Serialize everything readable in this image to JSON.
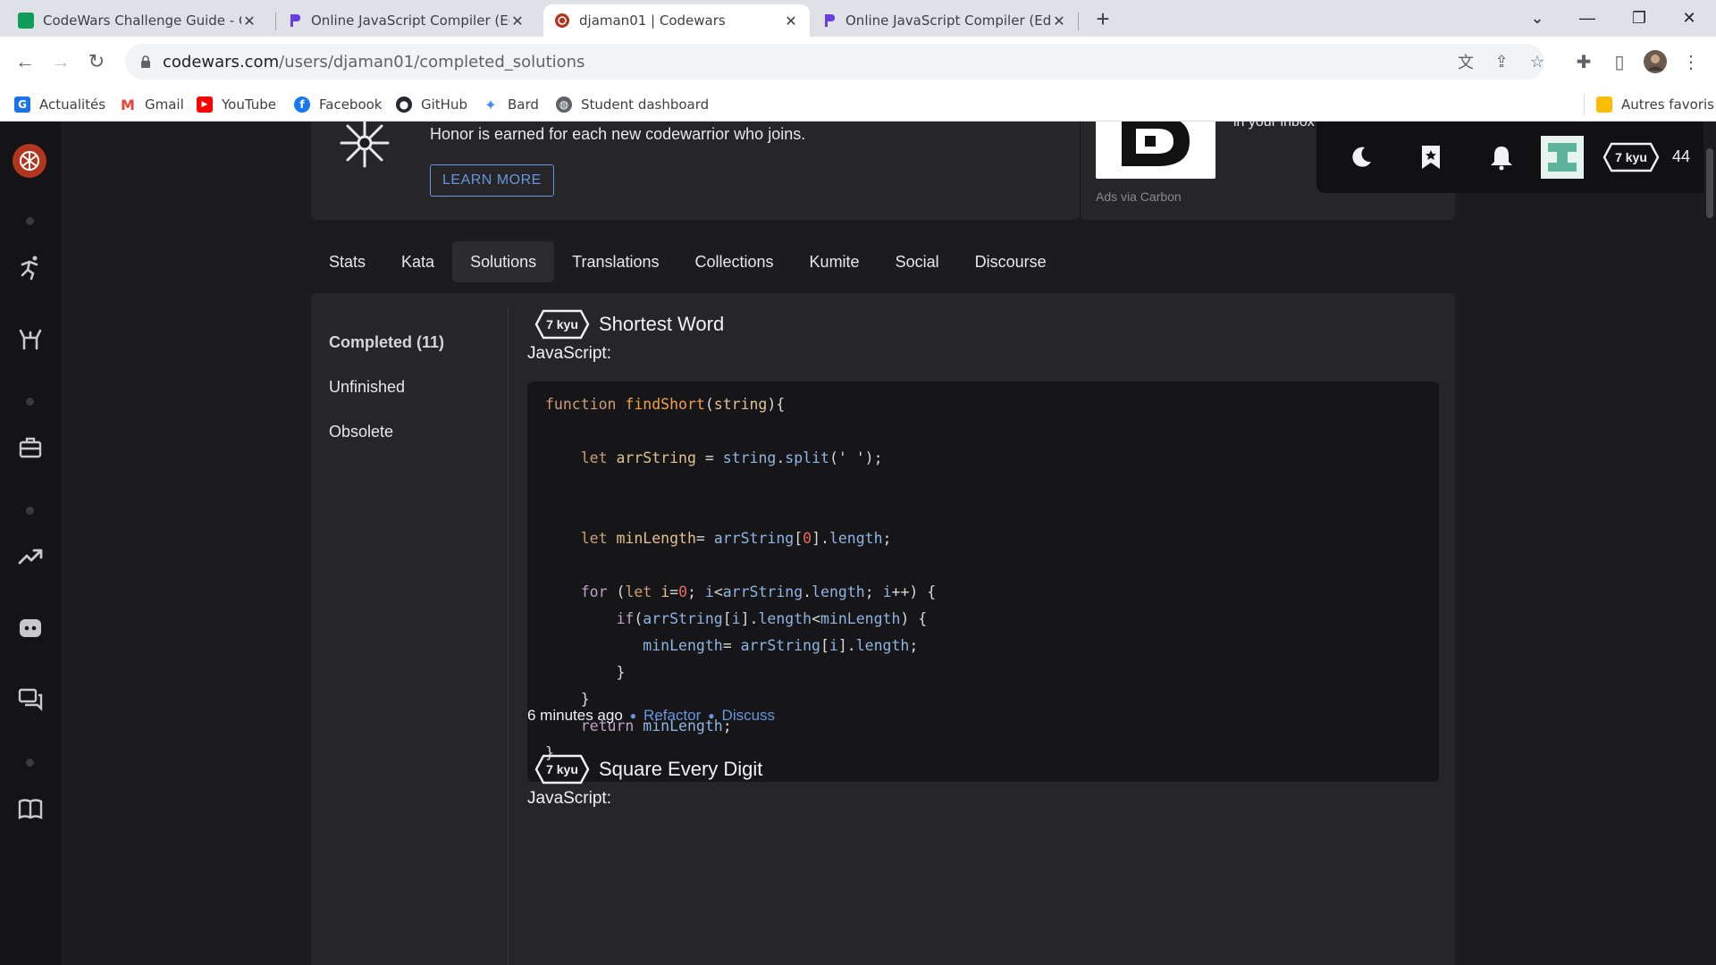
{
  "browser": {
    "tabs": [
      {
        "title": "CodeWars Challenge Guide - Google Sheets",
        "icon": "sheets-icon",
        "color": "#0f9d58"
      },
      {
        "title": "Online JavaScript Compiler (Editor)",
        "icon": "programiz-icon",
        "color": "#6c3de0"
      },
      {
        "title": "djaman01 | Codewars",
        "icon": "codewars-icon",
        "color": "#b1361e"
      },
      {
        "title": "Online JavaScript Compiler (Editor)",
        "icon": "programiz-icon",
        "color": "#6c3de0"
      }
    ],
    "new_tab": "+",
    "url_host": "codewars.com",
    "url_path": "/users/djaman01/completed_solutions",
    "bookmarks": [
      {
        "label": "Actualités",
        "icon": "news-icon",
        "color": "#1a73e8"
      },
      {
        "label": "Gmail",
        "icon": "gmail-icon",
        "color": "#ea4335"
      },
      {
        "label": "YouTube",
        "icon": "youtube-icon",
        "color": "#ff0000"
      },
      {
        "label": "Facebook",
        "icon": "facebook-icon",
        "color": "#1877f2"
      },
      {
        "label": "GitHub",
        "icon": "github-icon",
        "color": "#24292f"
      },
      {
        "label": "Bard",
        "icon": "bard-icon",
        "color": "#4285f4"
      },
      {
        "label": "Student dashboard",
        "icon": "globe-icon",
        "color": "#5f6368"
      }
    ],
    "other_bookmarks": "Autres favoris"
  },
  "banner": {
    "honor_text": "Honor is earned for each new codewarrior who joins.",
    "learn_more": "LEARN MORE",
    "ad_caption": "Ads via Carbon",
    "ad_text": "in your inbox"
  },
  "user_bar": {
    "rank": "7 kyu",
    "honor": "44"
  },
  "profile_tabs": [
    "Stats",
    "Kata",
    "Solutions",
    "Translations",
    "Collections",
    "Kumite",
    "Social",
    "Discourse"
  ],
  "active_tab": "Solutions",
  "side_menu": [
    "Completed (11)",
    "Unfinished",
    "Obsolete"
  ],
  "solutions": [
    {
      "rank": "7 kyu",
      "title": "Shortest Word",
      "language": "JavaScript:",
      "time": "6 minutes ago",
      "refactor": "Refactor",
      "discuss": "Discuss"
    },
    {
      "rank": "7 kyu",
      "title": "Square Every Digit",
      "language": "JavaScript:"
    }
  ],
  "colors": {
    "accent_blue": "#6795de",
    "codewars_red": "#b1361e",
    "background": "#1c1c1e"
  }
}
